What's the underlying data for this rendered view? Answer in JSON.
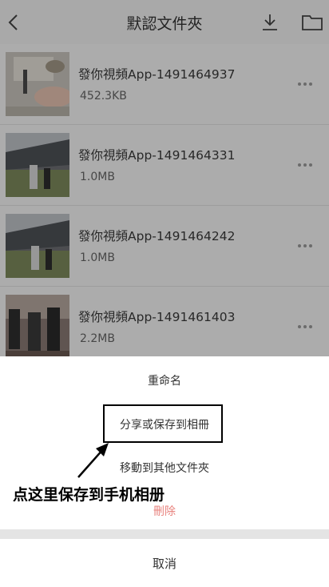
{
  "header": {
    "title": "默認文件夾",
    "back_icon": "chevron-left-icon",
    "download_icon": "download-icon",
    "folder_icon": "folder-icon"
  },
  "files": [
    {
      "name": "發你視頻App-1491464937",
      "size": "452.3KB"
    },
    {
      "name": "發你視頻App-1491464331",
      "size": "1.0MB"
    },
    {
      "name": "發你視頻App-1491464242",
      "size": "1.0MB"
    },
    {
      "name": "發你視頻App-1491461403",
      "size": "2.2MB"
    }
  ],
  "sheet": {
    "rename": "重命名",
    "share": "分享或保存到相冊",
    "move": "移動到其他文件夾",
    "delete": "刪除",
    "cancel": "取消"
  },
  "annotation": {
    "text": "点这里保存到手机相册"
  },
  "colors": {
    "delete": "#e8837e",
    "overlay": "rgba(0,0,0,0.3)"
  }
}
